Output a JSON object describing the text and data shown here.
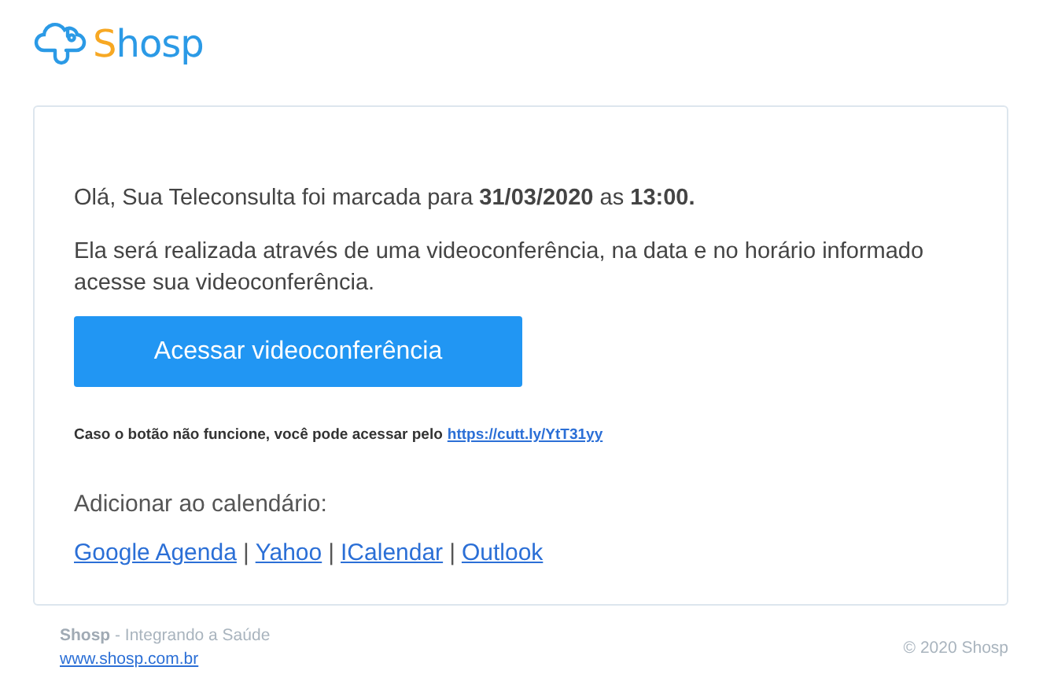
{
  "logo": {
    "accent": "S",
    "rest": "hosp"
  },
  "message": {
    "greeting": "Olá, Sua Teleconsulta foi marcada para **31/03/2020** as **13:00.**",
    "body": "Ela será realizada através de uma videoconferência, na data e no horário informado acesse sua videoconferência.",
    "button": "Acessar videoconferência",
    "fallback": "Caso o botão não funcione, você pode acessar pelo",
    "fallback_link": "https://cutt.ly/YtT31yy",
    "calendar_heading": "Adicionar ao calendário:",
    "calendar_links": [
      "Google Agenda",
      "Yahoo",
      "ICalendar",
      "Outlook"
    ],
    "separator": "|"
  },
  "footer": {
    "brand": "**Shosp** - Integrando a Saúde",
    "website": "www.shosp.com.br",
    "copyright": "© 2020 Shosp"
  }
}
